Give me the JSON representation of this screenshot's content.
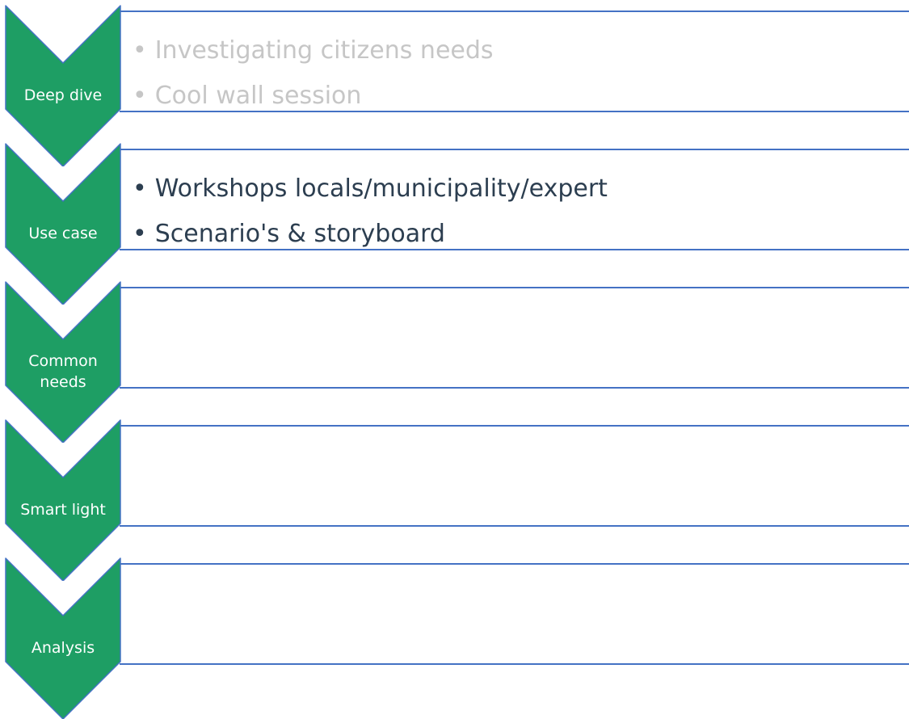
{
  "steps": [
    {
      "label": "Deep dive",
      "bullets": [
        "Investigating citizens needs",
        "Cool wall session"
      ],
      "bullet_style": "muted"
    },
    {
      "label": "Use case",
      "bullets": [
        "Workshops locals/municipality/expert",
        "Scenario's & storyboard"
      ],
      "bullet_style": "active"
    },
    {
      "label": "Common\nneeds",
      "bullets": [],
      "bullet_style": "active"
    },
    {
      "label": "Smart light",
      "bullets": [],
      "bullet_style": "active"
    },
    {
      "label": "Analysis",
      "bullets": [],
      "bullet_style": "active"
    }
  ],
  "colors": {
    "chevron_fill": "#1e9e64",
    "chevron_stroke": "#4472c4",
    "panel_border": "#4472c4",
    "muted_text": "#c6c6c6",
    "active_text": "#2c3e50"
  }
}
